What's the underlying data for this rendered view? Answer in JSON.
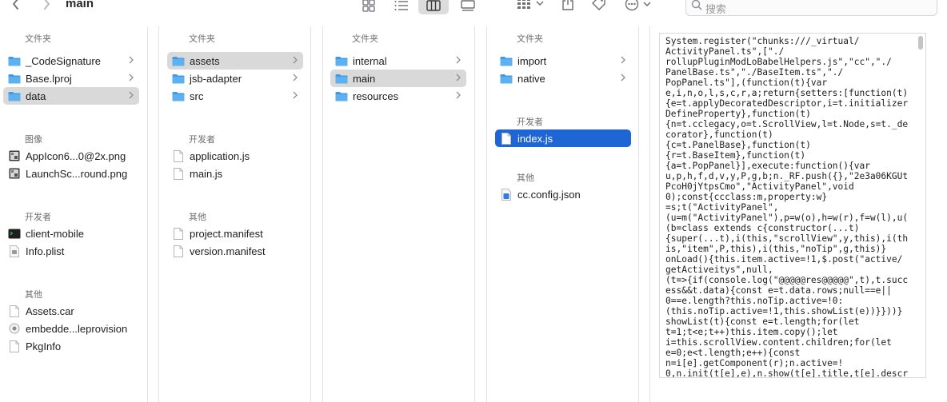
{
  "window": {
    "title": "main"
  },
  "toolbar": {
    "back_icon": "chevron-left-icon",
    "forward_icon": "chevron-right-icon",
    "view_icons": [
      "icon-view-icon",
      "list-view-icon",
      "column-view-icon",
      "gallery-view-icon"
    ],
    "group_icon": "group-icon",
    "share_icon": "share-icon",
    "tag_icon": "tag-icon",
    "more_icon": "more-icon",
    "search_placeholder": "搜索"
  },
  "columns": [
    {
      "sections": [
        {
          "header": "文件夹",
          "items": [
            {
              "label": "_CodeSignature",
              "icon": "folder-icon",
              "chevron": true
            },
            {
              "label": "Base.lproj",
              "icon": "folder-icon",
              "chevron": true
            },
            {
              "label": "data",
              "icon": "folder-icon",
              "chevron": true,
              "selected": "grey"
            }
          ]
        },
        {
          "header": "图像",
          "items": [
            {
              "label": "AppIcon6...0@2x.png",
              "icon": "image-file-icon"
            },
            {
              "label": "LaunchSc...round.png",
              "icon": "image-file-icon"
            }
          ]
        },
        {
          "header": "开发者",
          "items": [
            {
              "label": "client-mobile",
              "icon": "terminal-icon"
            },
            {
              "label": "Info.plist",
              "icon": "plist-file-icon"
            }
          ]
        },
        {
          "header": "其他",
          "items": [
            {
              "label": "Assets.car",
              "icon": "file-icon"
            },
            {
              "label": "embedde...leprovision",
              "icon": "provision-file-icon"
            },
            {
              "label": "PkgInfo",
              "icon": "file-icon"
            }
          ]
        }
      ]
    },
    {
      "sections": [
        {
          "header": "文件夹",
          "items": [
            {
              "label": "assets",
              "icon": "folder-icon",
              "chevron": true,
              "selected": "grey"
            },
            {
              "label": "jsb-adapter",
              "icon": "folder-icon",
              "chevron": true
            },
            {
              "label": "src",
              "icon": "folder-icon",
              "chevron": true
            }
          ]
        },
        {
          "header": "开发者",
          "items": [
            {
              "label": "application.js",
              "icon": "js-file-icon"
            },
            {
              "label": "main.js",
              "icon": "js-file-icon"
            }
          ]
        },
        {
          "header": "其他",
          "items": [
            {
              "label": "project.manifest",
              "icon": "file-icon"
            },
            {
              "label": "version.manifest",
              "icon": "file-icon"
            }
          ]
        }
      ]
    },
    {
      "sections": [
        {
          "header": "文件夹",
          "items": [
            {
              "label": "internal",
              "icon": "folder-icon",
              "chevron": true
            },
            {
              "label": "main",
              "icon": "folder-icon",
              "chevron": true,
              "selected": "grey"
            },
            {
              "label": "resources",
              "icon": "folder-icon",
              "chevron": true
            }
          ]
        }
      ]
    },
    {
      "sections": [
        {
          "header": "文件夹",
          "items": [
            {
              "label": "import",
              "icon": "folder-icon",
              "chevron": true
            },
            {
              "label": "native",
              "icon": "folder-icon",
              "chevron": true
            }
          ]
        },
        {
          "header": "开发者",
          "items": [
            {
              "label": "index.js",
              "icon": "js-file-icon",
              "selected": "blue"
            }
          ]
        },
        {
          "header": "其他",
          "items": [
            {
              "label": "cc.config.json",
              "icon": "json-file-icon"
            }
          ]
        }
      ]
    }
  ],
  "preview": {
    "lines": [
      "System.register(\"chunks:///_virtual/",
      "ActivityPanel.ts\",[\"./",
      "rollupPluginModLoBabelHelpers.js\",\"cc\",\"./",
      "PanelBase.ts\",\"./BaseItem.ts\",\"./",
      "PopPanel.ts\"],(function(t){var",
      "e,i,n,o,l,s,c,r,a;return{setters:[function(t)",
      "{e=t.applyDecoratedDescriptor,i=t.initializer",
      "DefineProperty},function(t)",
      "{n=t.cclegacy,o=t.ScrollView,l=t.Node,s=t._de",
      "corator},function(t)",
      "{c=t.PanelBase},function(t)",
      "{r=t.BaseItem},function(t)",
      "{a=t.PopPanel}],execute:function(){var",
      "u,p,h,f,d,v,y,P,g,b;n._RF.push({},\"2e3a06KGUt",
      "PcoH0jYtpsCmo\",\"ActivityPanel\",void",
      "0);const{ccclass:m,property:w}",
      "=s;t(\"ActivityPanel\",",
      "(u=m(\"ActivityPanel\"),p=w(o),h=w(r),f=w(l),u(",
      "(b=class extends c{constructor(...t)",
      "{super(...t),i(this,\"scrollView\",y,this),i(th",
      "is,\"item\",P,this),i(this,\"noTip\",g,this)}",
      "onLoad(){this.item.active=!1,$.post(\"active/",
      "getActiveitys\",null,",
      "(t=>{if(console.log(\"@@@@@res@@@@@\",t),t.succ",
      "ess&&t.data){const e=t.data.rows;null==e||",
      "0==e.length?this.noTip.active=!0:",
      "(this.noTip.active=!1,this.showList(e))}}))}",
      "showList(t){const e=t.length;for(let",
      "t=1;t<e;t++)this.item.copy();let",
      "i=this.scrollView.content.children;for(let",
      "e=0;e<t.length;e++){const",
      "n=i[e].getComponent(r);n.active=!",
      "0,n.init(t[e],e),n.show(t[e].title,t[e].descr"
    ]
  }
}
